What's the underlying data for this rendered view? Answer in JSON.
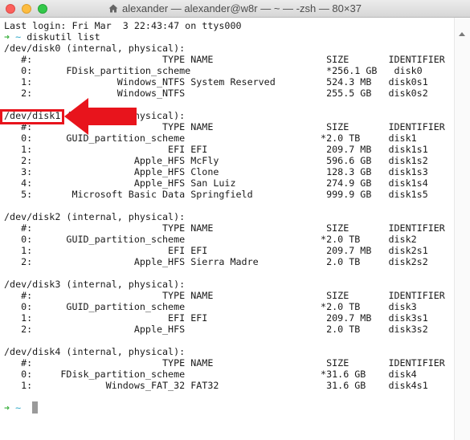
{
  "window": {
    "title": "alexander — alexander@w8r — ~ — -zsh — 80×37",
    "title_icon": "home-icon"
  },
  "prompt": {
    "arrow": "➜",
    "dir": "~"
  },
  "login_line": "Last login: Fri Mar  3 22:43:47 on ttys000",
  "command": "diskutil list",
  "disk_lines": [
    "/dev/disk0 (internal, physical):",
    "   #:                       TYPE NAME                    SIZE       IDENTIFIER",
    "   0:      FDisk_partition_scheme                        *256.1 GB   disk0",
    "   1:               Windows_NTFS System Reserved         524.3 MB   disk0s1",
    "   2:               Windows_NTFS                         255.5 GB   disk0s2",
    "",
    "/dev/disk1 (internal, physical):",
    "   #:                       TYPE NAME                    SIZE       IDENTIFIER",
    "   0:      GUID_partition_scheme                        *2.0 TB     disk1",
    "   1:                        EFI EFI                     209.7 MB   disk1s1",
    "   2:                  Apple_HFS McFly                   596.6 GB   disk1s2",
    "   3:                  Apple_HFS Clone                   128.3 GB   disk1s3",
    "   4:                  Apple_HFS San Luiz                274.9 GB   disk1s4",
    "   5:       Microsoft Basic Data Springfield             999.9 GB   disk1s5",
    "",
    "/dev/disk2 (internal, physical):",
    "   #:                       TYPE NAME                    SIZE       IDENTIFIER",
    "   0:      GUID_partition_scheme                        *2.0 TB     disk2",
    "   1:                        EFI EFI                     209.7 MB   disk2s1",
    "   2:                  Apple_HFS Sierra Madre            2.0 TB     disk2s2",
    "",
    "/dev/disk3 (internal, physical):",
    "   #:                       TYPE NAME                    SIZE       IDENTIFIER",
    "   0:      GUID_partition_scheme                        *2.0 TB     disk3",
    "   1:                        EFI EFI                     209.7 MB   disk3s1",
    "   2:                  Apple_HFS                         2.0 TB     disk3s2",
    "",
    "/dev/disk4 (internal, physical):",
    "   #:                       TYPE NAME                    SIZE       IDENTIFIER",
    "   0:     FDisk_partition_scheme                        *31.6 GB    disk4",
    "   1:             Windows_FAT_32 FAT32                   31.6 GB    disk4s1"
  ],
  "annotation": {
    "highlight_target": "/dev/disk1",
    "arrow_color": "#e8141c"
  },
  "colors": {
    "prompt_arrow": "#3ab03e",
    "prompt_dir": "#2fa8c8",
    "text": "#1a1a1a",
    "annotation_red": "#e8141c"
  }
}
